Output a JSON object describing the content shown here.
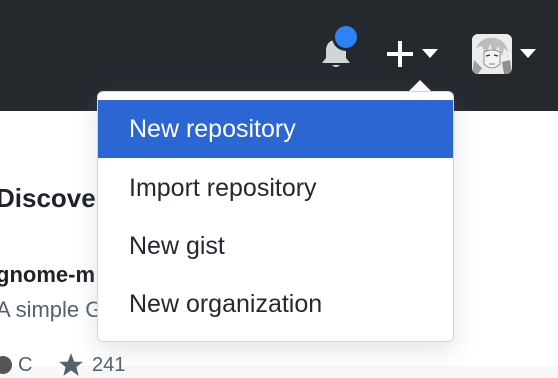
{
  "header": {
    "notifications_icon": "bell-icon",
    "notification_indicator_color": "#2f81f7",
    "create_icon": "plus-icon",
    "create_caret_icon": "caret-down-icon",
    "avatar_caret_icon": "caret-down-icon"
  },
  "create_menu": {
    "items": [
      {
        "label": "New repository",
        "active": true
      },
      {
        "label": "Import repository",
        "active": false
      },
      {
        "label": "New gist",
        "active": false
      },
      {
        "label": "New organization",
        "active": false
      }
    ],
    "active_color": "#2b66d3"
  },
  "background": {
    "section_title": "Discove",
    "repo_name": "gnome-m",
    "repo_description": "A simple G",
    "repo_language": "C",
    "repo_stars": "241"
  }
}
